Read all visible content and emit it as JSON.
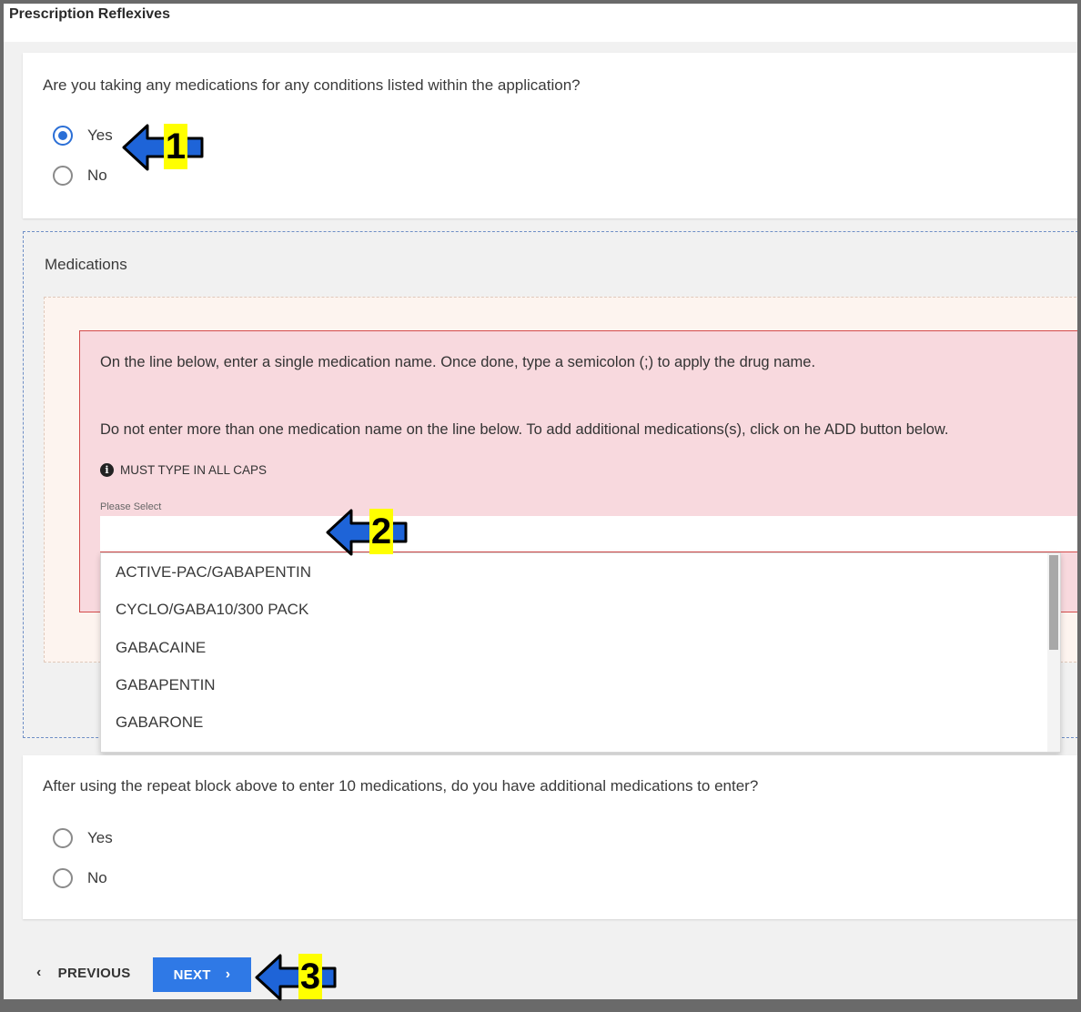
{
  "page": {
    "title": "Prescription Reflexives"
  },
  "q1": {
    "question": "Are you taking any medications for any conditions listed within the application?",
    "options": [
      {
        "label": "Yes",
        "checked": true
      },
      {
        "label": "No",
        "checked": false
      }
    ]
  },
  "medications": {
    "title": "Medications",
    "instruction1": "On the line below, enter a single medication name.  Once done, type a semicolon (;) to apply the drug name.",
    "instruction2": "Do not enter more than one medication name on the line below.  To add additional medications(s), click on he ADD button below.",
    "caps_note": "MUST TYPE IN ALL CAPS",
    "info_icon": "i",
    "field_label": "Please Select",
    "input_value": "",
    "dropdown_options": [
      "ACTIVE-PAC/GABAPENTIN",
      "CYCLO/GABA10/300 PACK",
      "GABACAINE",
      "GABAPENTIN",
      "GABARONE"
    ]
  },
  "q2": {
    "question": "After using the repeat block above to enter 10 medications, do you have additional medications to enter?",
    "options": [
      {
        "label": "Yes",
        "checked": false
      },
      {
        "label": "No",
        "checked": false
      }
    ]
  },
  "nav": {
    "previous_label": "PREVIOUS",
    "next_label": "NEXT",
    "prev_icon": "‹",
    "next_icon": "›"
  },
  "callouts": {
    "c1": "1",
    "c2": "2",
    "c3": "3",
    "arrow_color": "#1e64d8",
    "badge_color": "#ffff00"
  }
}
